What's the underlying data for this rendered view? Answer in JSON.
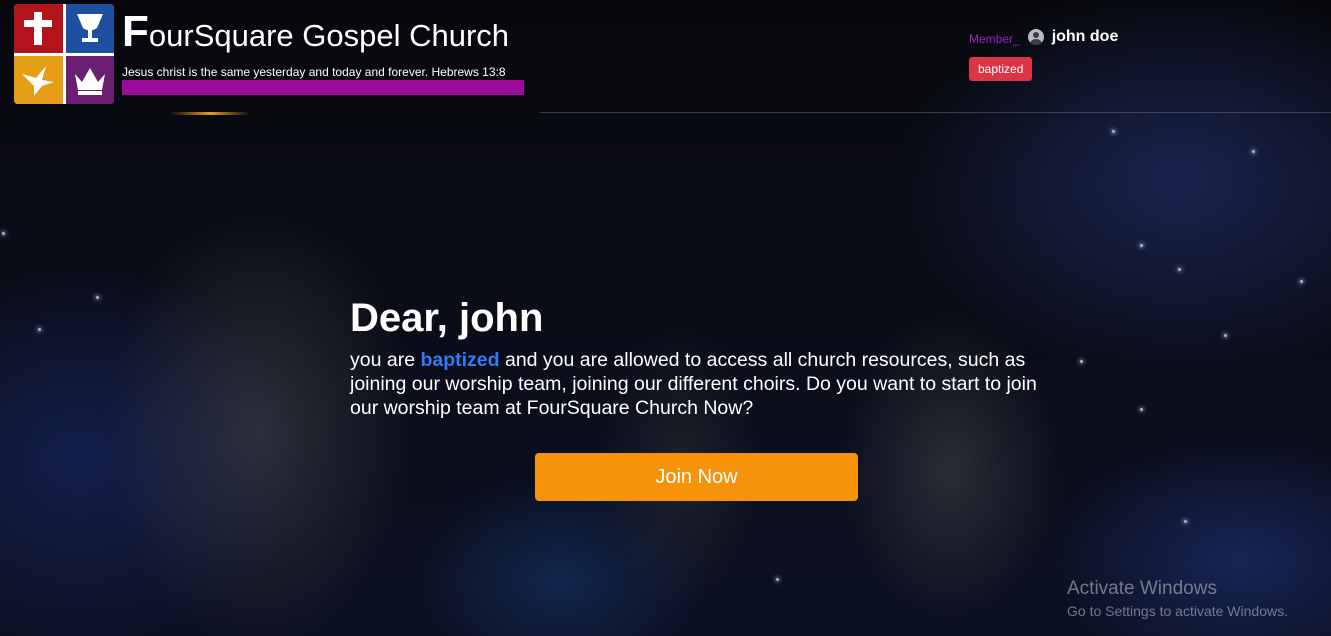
{
  "brand": {
    "title_initial": "F",
    "title_rest": "ourSquare Gospel Church",
    "tagline": "Jesus christ is the same yesterday and today and forever. Hebrews 13:8",
    "logo_icons": [
      "cross-icon",
      "chalice-icon",
      "dove-icon",
      "crown-icon"
    ]
  },
  "user": {
    "member_label": "Member_",
    "name": "john doe",
    "status_badge": "baptized"
  },
  "hero": {
    "greeting": "Dear, john",
    "message_pre": "you are ",
    "message_highlight": "baptized",
    "message_post": " and you are allowed to access all church resources, such as joining our worship team, joining our different choirs. Do you want to start to join our worship team at FourSquare Church Now?",
    "cta_label": "Join Now"
  },
  "watermark": {
    "title": "Activate Windows",
    "subtitle": "Go to Settings to activate Windows."
  },
  "colors": {
    "accent_orange": "#f7930a",
    "tag_bar_purple": "#9c0b99",
    "badge_red": "#dc3545",
    "highlight_blue": "#2f7cf6",
    "member_label_purple": "#a11fcf"
  }
}
